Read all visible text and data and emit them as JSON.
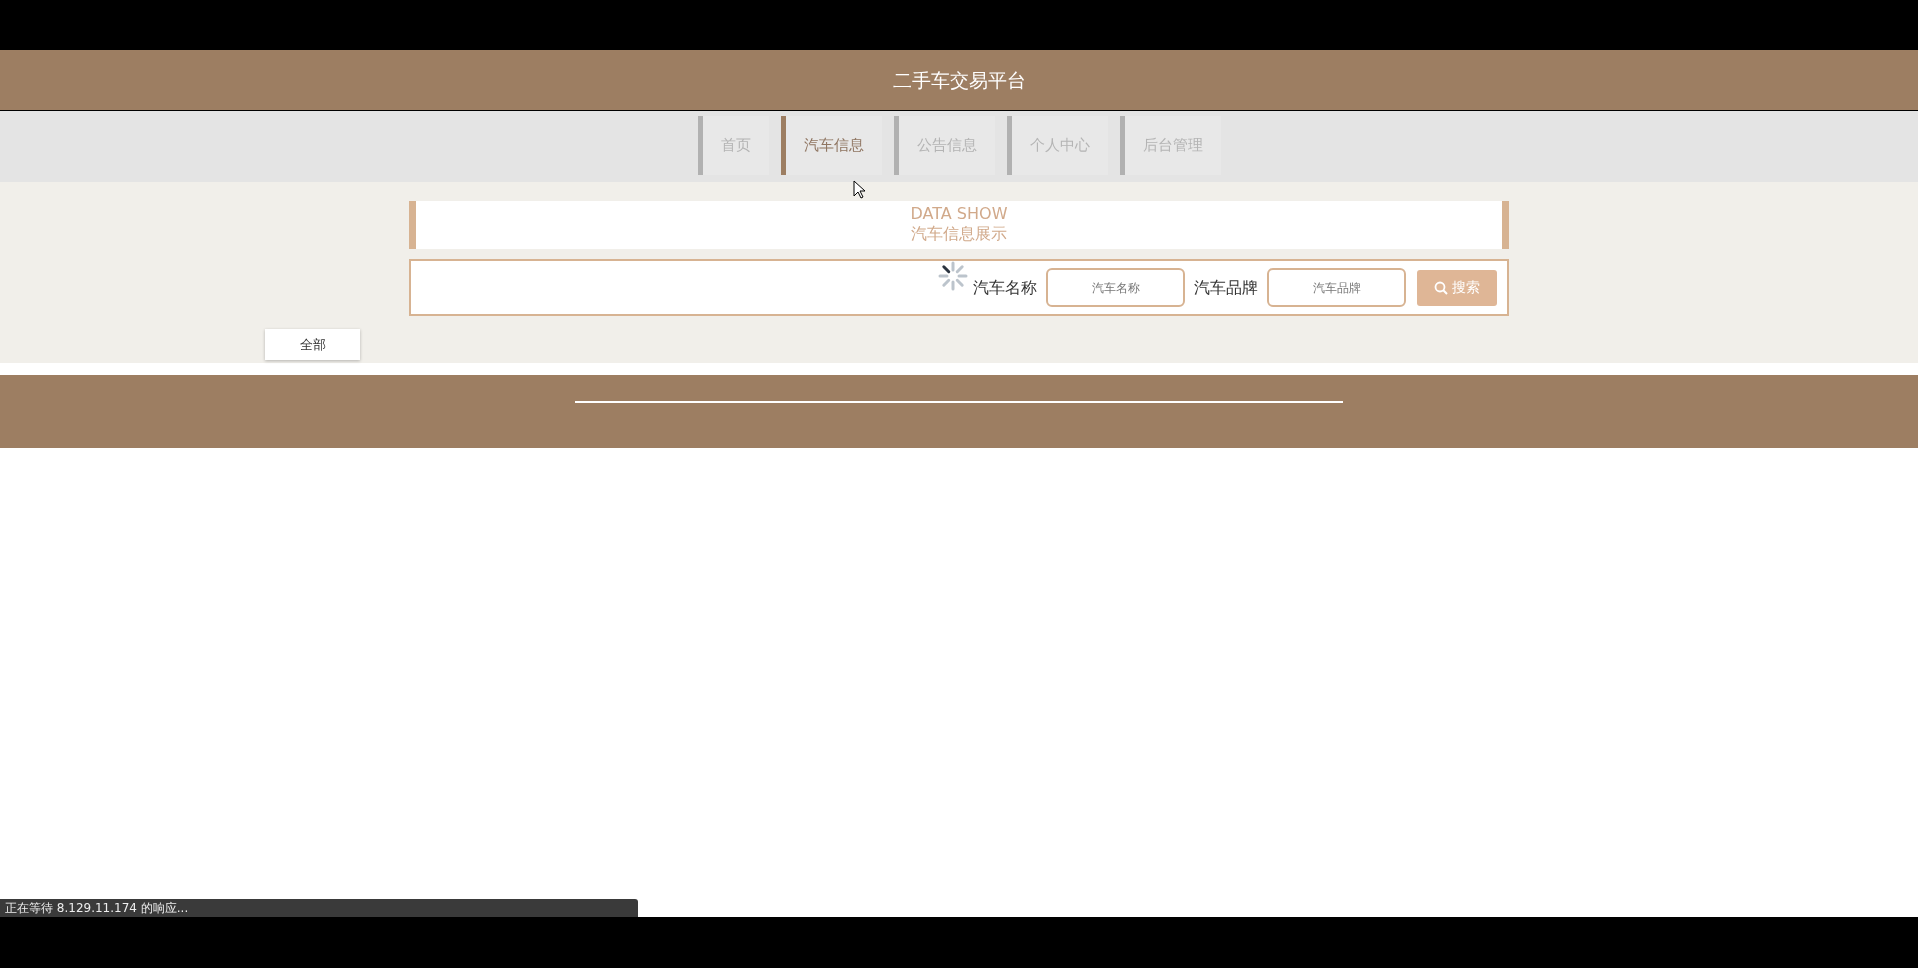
{
  "header": {
    "title": "二手车交易平台"
  },
  "nav": [
    {
      "label": "首页",
      "selected": false
    },
    {
      "label": "汽车信息",
      "selected": true
    },
    {
      "label": "公告信息",
      "selected": false
    },
    {
      "label": "个人中心",
      "selected": false
    },
    {
      "label": "后台管理",
      "selected": false
    }
  ],
  "banner": {
    "title": "DATA SHOW",
    "subtitle": "汽车信息展示"
  },
  "search": {
    "fields": [
      {
        "label": "汽车名称",
        "placeholder": "汽车名称"
      },
      {
        "label": "汽车品牌",
        "placeholder": "汽车品牌"
      }
    ],
    "button": "搜索"
  },
  "category_button": "全部",
  "status_bar": "正在等待 8.129.11.174 的响应..."
}
